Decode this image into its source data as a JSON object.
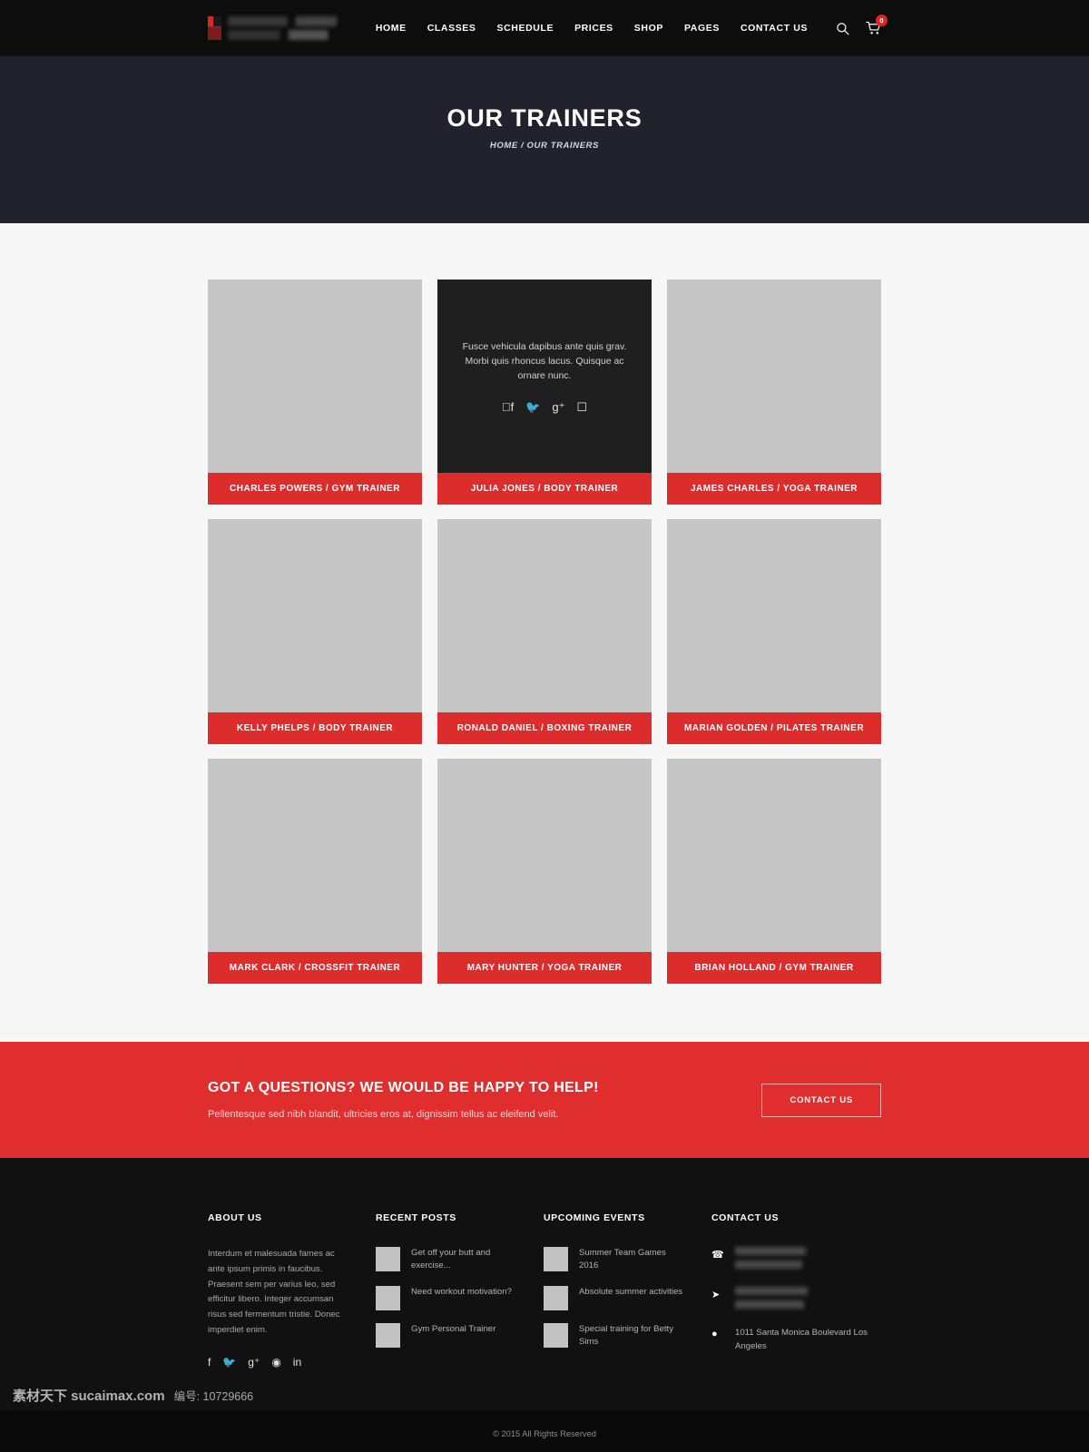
{
  "header": {
    "logo_alt": "gym-logo",
    "nav": [
      {
        "label": "HOME"
      },
      {
        "label": "CLASSES"
      },
      {
        "label": "SCHEDULE"
      },
      {
        "label": "PRICES"
      },
      {
        "label": "SHOP"
      },
      {
        "label": "PAGES"
      },
      {
        "label": "CONTACT US"
      }
    ],
    "search_icon": "search-icon",
    "cart_icon": "cart-icon",
    "cart_count": "0"
  },
  "banner": {
    "title": "OUR TRAINERS",
    "breadcrumb": "HOME / OUR TRAINERS"
  },
  "trainers": [
    {
      "name": "CHARLES POWERS / GYM TRAINER",
      "active": false
    },
    {
      "name": "JULIA JONES / BODY TRAINER",
      "active": true,
      "bio": "Fusce vehicula dapibus ante quis grav. Morbi quis rhoncus lacus. Quisque ac ornare nunc.",
      "socials": [
        "facebook-icon",
        "twitter-icon",
        "google-plus-icon",
        "instagram-icon"
      ]
    },
    {
      "name": "JAMES CHARLES / YOGA TRAINER",
      "active": false
    },
    {
      "name": "KELLY PHELPS / BODY TRAINER",
      "active": false
    },
    {
      "name": "RONALD DANIEL / BOXING TRAINER",
      "active": false
    },
    {
      "name": "MARIAN GOLDEN / PILATES TRAINER",
      "active": false
    },
    {
      "name": "MARK CLARK / CROSSFIT TRAINER",
      "active": false
    },
    {
      "name": "MARY HUNTER / YOGA TRAINER",
      "active": false
    },
    {
      "name": "BRIAN HOLLAND / GYM TRAINER",
      "active": false
    }
  ],
  "cta": {
    "heading": "GOT A QUESTIONS? WE WOULD BE HAPPY TO HELP!",
    "subtext": "Pellentesque sed nibh blandit, ultricies eros at, dignissim tellus ac eleifend velit.",
    "button_label": "CONTACT US"
  },
  "footer": {
    "about": {
      "title": "ABOUT US",
      "text": "Interdum et malesuada fames ac ante ipsum primis in faucibus. Praesent sem per varius leo, sed efficitur libero. Integer accumsan risus sed fermentum tristie. Donec imperdiet enim.",
      "socials": [
        "facebook-icon",
        "twitter-icon",
        "google-plus-icon",
        "dribbble-icon",
        "linkedin-icon"
      ]
    },
    "recent_posts": {
      "title": "RECENT POSTS",
      "items": [
        {
          "text": "Get off your butt and exercise..."
        },
        {
          "text": "Need workout motivation?"
        },
        {
          "text": "Gym Personal Trainer"
        }
      ]
    },
    "upcoming_events": {
      "title": "UPCOMING EVENTS",
      "items": [
        {
          "text": "Summer Team Games 2016"
        },
        {
          "text": "Absolute summer activities"
        },
        {
          "text": "Special training for Betty Sims"
        }
      ]
    },
    "contact": {
      "title": "CONTACT US",
      "phone_icon": "phone-icon",
      "phone": "",
      "email_icon": "send-icon",
      "email": "",
      "address_icon": "map-pin-icon",
      "address": "1011 Santa Monica Boulevard Los Angeles"
    },
    "copyright": "© 2015 All Rights Reserved"
  },
  "watermark": {
    "main": "素材天下 sucaimax.com",
    "sub": "编号: 10729666"
  },
  "colors": {
    "accent": "#dc2c2c",
    "header_bg": "#0d0d0d",
    "banner_bg": "#22212e",
    "footer_bg": "#111111"
  }
}
